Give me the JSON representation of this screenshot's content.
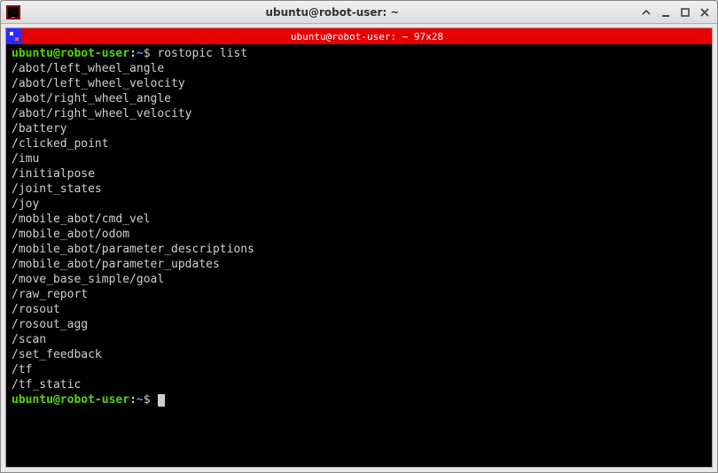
{
  "window": {
    "title": "ubuntu@robot-user: ~"
  },
  "tab": {
    "title": "ubuntu@robot-user: ~ 97x28"
  },
  "prompt": {
    "user_host": "ubuntu@robot-user",
    "colon": ":",
    "path": "~",
    "dollar": "$"
  },
  "command": "rostopic list",
  "output": [
    "/abot/left_wheel_angle",
    "/abot/left_wheel_velocity",
    "/abot/right_wheel_angle",
    "/abot/right_wheel_velocity",
    "/battery",
    "/clicked_point",
    "/imu",
    "/initialpose",
    "/joint_states",
    "/joy",
    "/mobile_abot/cmd_vel",
    "/mobile_abot/odom",
    "/mobile_abot/parameter_descriptions",
    "/mobile_abot/parameter_updates",
    "/move_base_simple/goal",
    "/raw_report",
    "/rosout",
    "/rosout_agg",
    "/scan",
    "/set_feedback",
    "/tf",
    "/tf_static"
  ]
}
